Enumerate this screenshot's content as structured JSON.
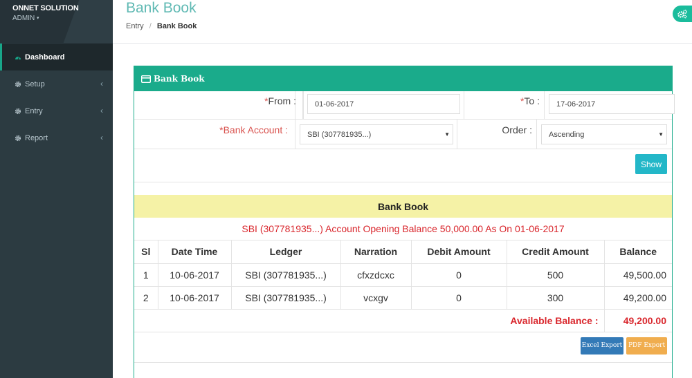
{
  "brand": {
    "name": "ONNET SOLUTION",
    "role": "ADMIN",
    "caret": "▾"
  },
  "sidebar": {
    "items": [
      {
        "label": "Dashboard",
        "icon": "dashboard-icon",
        "active": true
      },
      {
        "label": "Setup",
        "icon": "gear-icon",
        "chevron": "‹"
      },
      {
        "label": "Entry",
        "icon": "gear-icon",
        "chevron": "‹"
      },
      {
        "label": "Report",
        "icon": "gear-icon",
        "chevron": "‹"
      }
    ]
  },
  "header": {
    "title": "Bank Book",
    "breadcrumb": {
      "parent": "Entry",
      "separator": "/",
      "current": "Bank Book"
    }
  },
  "panel": {
    "title": "Bank Book"
  },
  "form": {
    "required_mark": "*",
    "from_label": "From :",
    "from_value": "01-06-2017",
    "to_label": "To :",
    "to_value": "17-06-2017",
    "bank_label": "Bank Account :",
    "bank_value": "SBI (307781935...)",
    "order_label": "Order :",
    "order_value": "Ascending",
    "select_arrow": "▼",
    "show_label": "Show"
  },
  "report": {
    "title": "Bank Book",
    "opening": "SBI (307781935...) Account Opening Balance 50,000.00 As On 01-06-2017",
    "columns": [
      "Sl",
      "Date Time",
      "Ledger",
      "Narration",
      "Debit Amount",
      "Credit Amount",
      "Balance"
    ],
    "rows": [
      [
        "1",
        "10-06-2017",
        "SBI (307781935...)",
        "cfxzdcxc",
        "0",
        "500",
        "49,500.00"
      ],
      [
        "2",
        "10-06-2017",
        "SBI (307781935...)",
        "vcxgv",
        "0",
        "300",
        "49,200.00"
      ]
    ],
    "total_label": "Available Balance :",
    "total_value": "49,200.00"
  },
  "exports": {
    "excel_label": "Excel Export",
    "pdf_label": "PDF Export"
  },
  "colors": {
    "accent": "#1aab8b",
    "sidebar": "#2c3b41",
    "title": "#5fb9b3",
    "danger": "#d9262c",
    "highlight": "#f5f2a6",
    "excel": "#337ab7",
    "pdf": "#f0ad4e",
    "show": "#23b7c8"
  }
}
